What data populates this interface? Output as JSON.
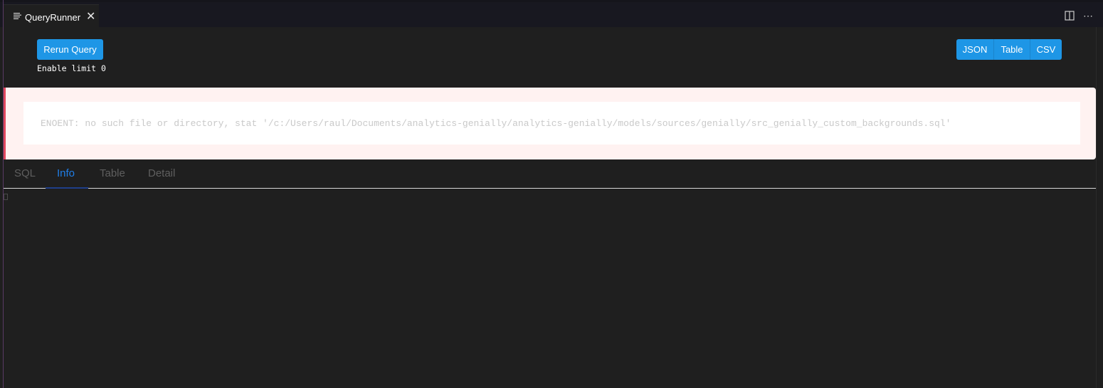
{
  "editor_tab": {
    "title": "QueryRunner",
    "icon": "file-lines-icon",
    "close_glyph": "✕"
  },
  "tab_actions": {
    "split_icon": "split-editor-icon",
    "more_glyph": "⋯"
  },
  "toolbar": {
    "rerun_label": "Rerun Query",
    "limit_text": "Enable limit 0",
    "formats": [
      "JSON",
      "Table",
      "CSV"
    ]
  },
  "error": {
    "message": "ENOENT: no such file or directory, stat '/c:/Users/raul/Documents/analytics-genially/analytics-genially/models/sources/genially/src_genially_custom_backgrounds.sql'"
  },
  "result_tabs": {
    "items": [
      "SQL",
      "Info",
      "Table",
      "Detail"
    ],
    "active": "Info"
  },
  "colors": {
    "accent": "#1e96e6",
    "active_tab": "#1f7ee8",
    "error_border": "#e0485e",
    "error_bg": "#fff2f1"
  }
}
